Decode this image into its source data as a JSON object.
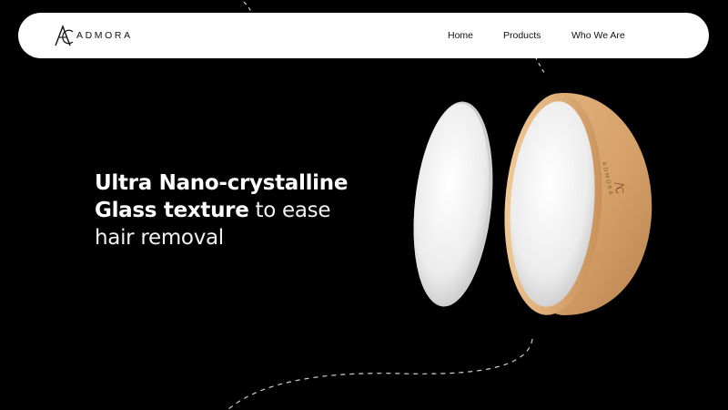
{
  "brand": {
    "name": "ADMORA",
    "logo_icon": "ac-monogram-icon"
  },
  "nav": {
    "items": [
      {
        "label": "Home"
      },
      {
        "label": "Products"
      },
      {
        "label": "Who We Are"
      }
    ]
  },
  "hero": {
    "line1_bold": "Ultra Nano-crystalline",
    "line2_bold": "Glass texture",
    "line2_light": " to ease",
    "line3_light": "hair removal"
  },
  "product_image": {
    "engraved_text": "ADMORA",
    "colors": {
      "wood": "#d9a873",
      "glass": "#f1f1f1"
    }
  },
  "colors": {
    "background": "#000000",
    "navbar": "#ffffff",
    "text_light": "#ffffff",
    "text_dark": "#111111"
  }
}
